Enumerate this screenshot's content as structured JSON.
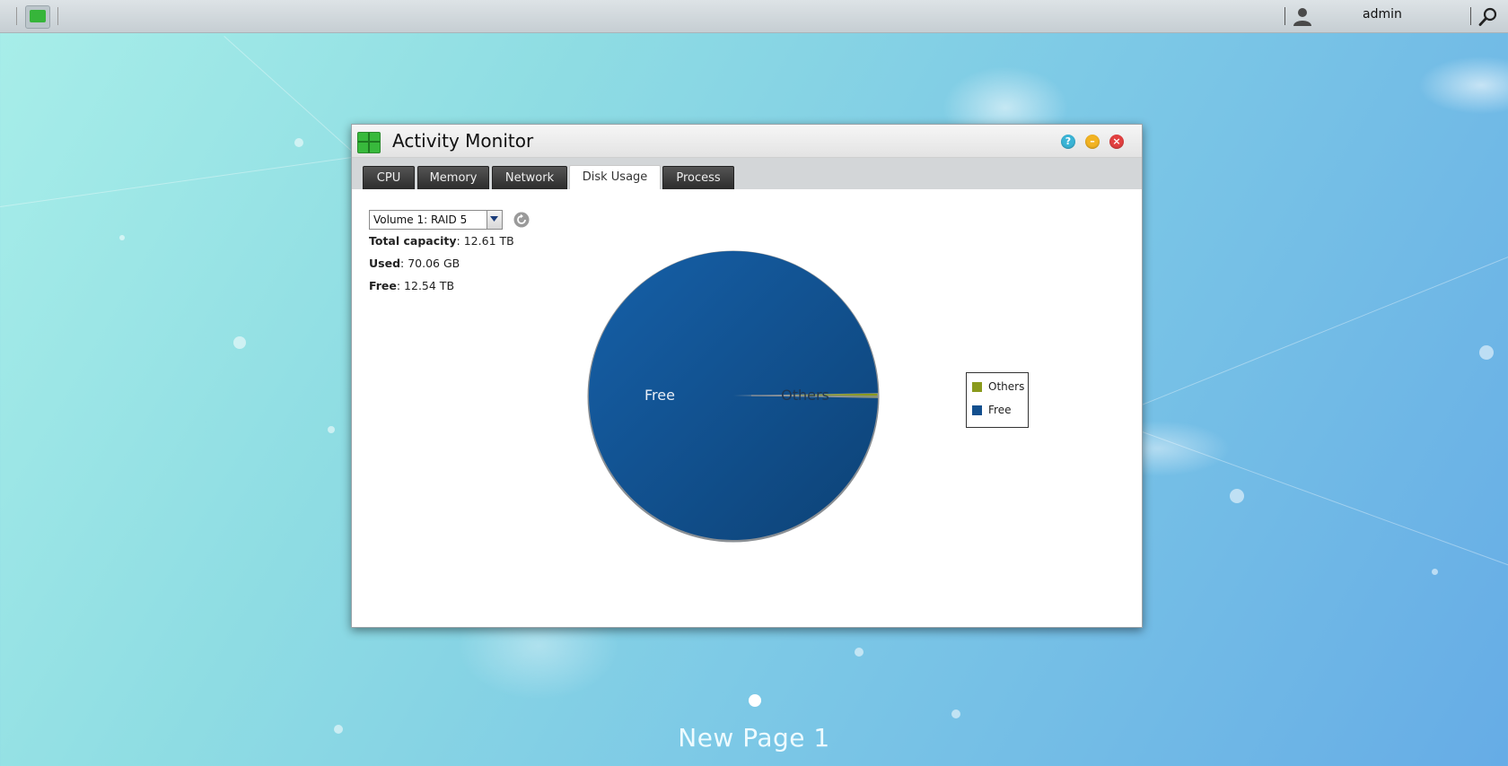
{
  "topbar": {
    "username": "admin"
  },
  "window": {
    "title": "Activity Monitor",
    "buttons": {
      "help": "?",
      "minimize": "–",
      "close": "×"
    }
  },
  "tabs": [
    {
      "label": "CPU"
    },
    {
      "label": "Memory"
    },
    {
      "label": "Network"
    },
    {
      "label": "Disk Usage"
    },
    {
      "label": "Process"
    }
  ],
  "active_tab": "Disk Usage",
  "disk": {
    "volume_selected": "Volume 1: RAID 5",
    "total_label": "Total capacity",
    "total_value": ": 12.61 TB",
    "used_label": "Used",
    "used_value": ": 70.06 GB",
    "free_label": "Free",
    "free_value": ": 12.54 TB"
  },
  "chart_data": {
    "type": "pie",
    "slices": [
      {
        "name": "Others",
        "value": 70.06,
        "color": "#8a9a1c"
      },
      {
        "name": "Free",
        "value": 12540,
        "color": "#124f8e"
      }
    ],
    "legend": [
      "Others",
      "Free"
    ],
    "legend_position": "right"
  },
  "desktop": {
    "page_label": "New Page 1"
  },
  "colors": {
    "others": "#8a9a1c",
    "free": "#124f8e"
  }
}
